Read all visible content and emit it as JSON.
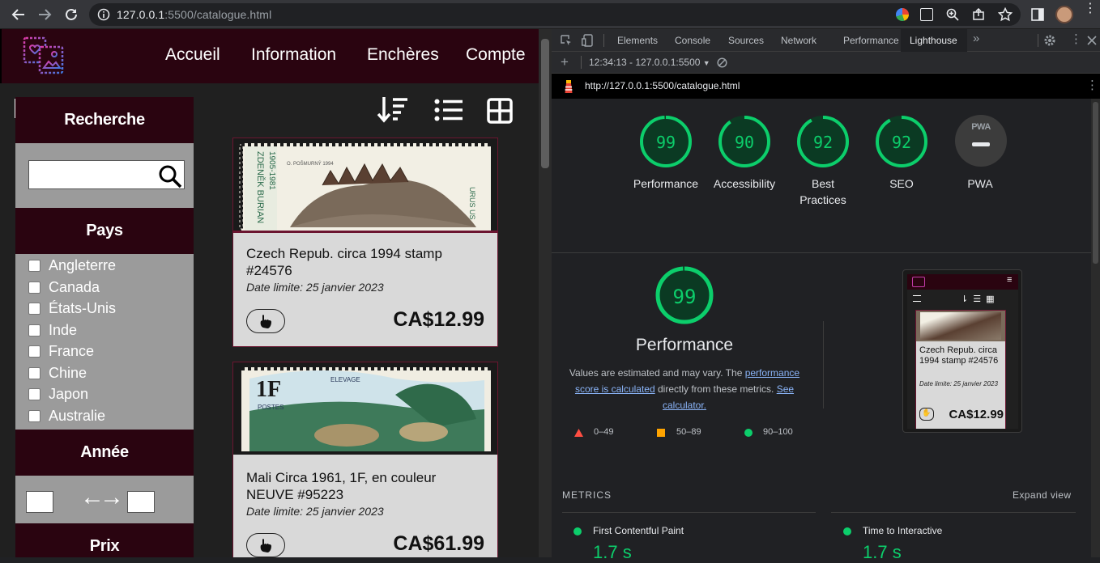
{
  "browser": {
    "url_host": "127.0.0.1",
    "url_rest": ":5500/catalogue.html"
  },
  "site": {
    "nav": [
      "Accueil",
      "Information",
      "Enchères",
      "Compte"
    ],
    "sidebar": {
      "search_heading": "Recherche",
      "country_heading": "Pays",
      "countries": [
        "Angleterre",
        "Canada",
        "États-Unis",
        "Inde",
        "France",
        "Chine",
        "Japon",
        "Australie"
      ],
      "year_heading": "Année",
      "year_arrow": "←→",
      "price_heading": "Prix"
    },
    "cards": [
      {
        "title": "Czech Repub. circa 1994 stamp #24576",
        "date": "Date limite: 25 janvier 2023",
        "price": "CA$12.99"
      },
      {
        "title": "Mali Circa 1961, 1F, en couleur NEUVE #95223",
        "date": "Date limite: 25 janvier 2023",
        "price": "CA$61.99"
      }
    ],
    "stamp1_texts": {
      "artist": "O. POŠMURNÝ 1994",
      "vertical": "ZDENĚK BURIAN",
      "years": "1905-1981",
      "species": "URUS US"
    },
    "stamp2_texts": {
      "denomination": "1F",
      "top": "ELEVAGE",
      "postes": "POSTES"
    }
  },
  "devtools": {
    "tabs": [
      "Elements",
      "Console",
      "Sources",
      "Network",
      "Performance",
      "Lighthouse"
    ],
    "active_tab": "Lighthouse",
    "report_select": "12:34:13 - 127.0.0.1:5500",
    "report_url": "http://127.0.0.1:5500/catalogue.html",
    "scores": [
      {
        "label": "Performance",
        "value": "99",
        "fraction": 0.99
      },
      {
        "label": "Accessibility",
        "value": "90",
        "fraction": 0.9
      },
      {
        "label": "Best Practices",
        "value": "92",
        "fraction": 0.92
      },
      {
        "label": "SEO",
        "value": "92",
        "fraction": 0.92
      }
    ],
    "pwa_label": "PWA",
    "pwa_badge": "PWA",
    "perf_big": {
      "value": "99",
      "fraction": 0.99,
      "title": "Performance"
    },
    "perf_note_1": "Values are estimated and may vary. The ",
    "perf_link_1": "performance score is calculated",
    "perf_note_2": " directly from these metrics. ",
    "perf_link_2": "See calculator.",
    "legend": [
      "0–49",
      "50–89",
      "90–100"
    ],
    "metrics_heading": "METRICS",
    "expand": "Expand view",
    "metrics": [
      {
        "name": "First Contentful Paint",
        "value": "1.7 s"
      },
      {
        "name": "Time to Interactive",
        "value": "1.7 s"
      }
    ],
    "thumb": {
      "title": "Czech Repub. circa 1994 stamp #24576",
      "date": "Date limite: 25 janvier 2023",
      "price": "CA$12.99"
    },
    "colors": {
      "pass": "#0cce6b",
      "average": "#ffa400",
      "fail": "#ff4e42",
      "link": "#8ab4f8"
    }
  }
}
